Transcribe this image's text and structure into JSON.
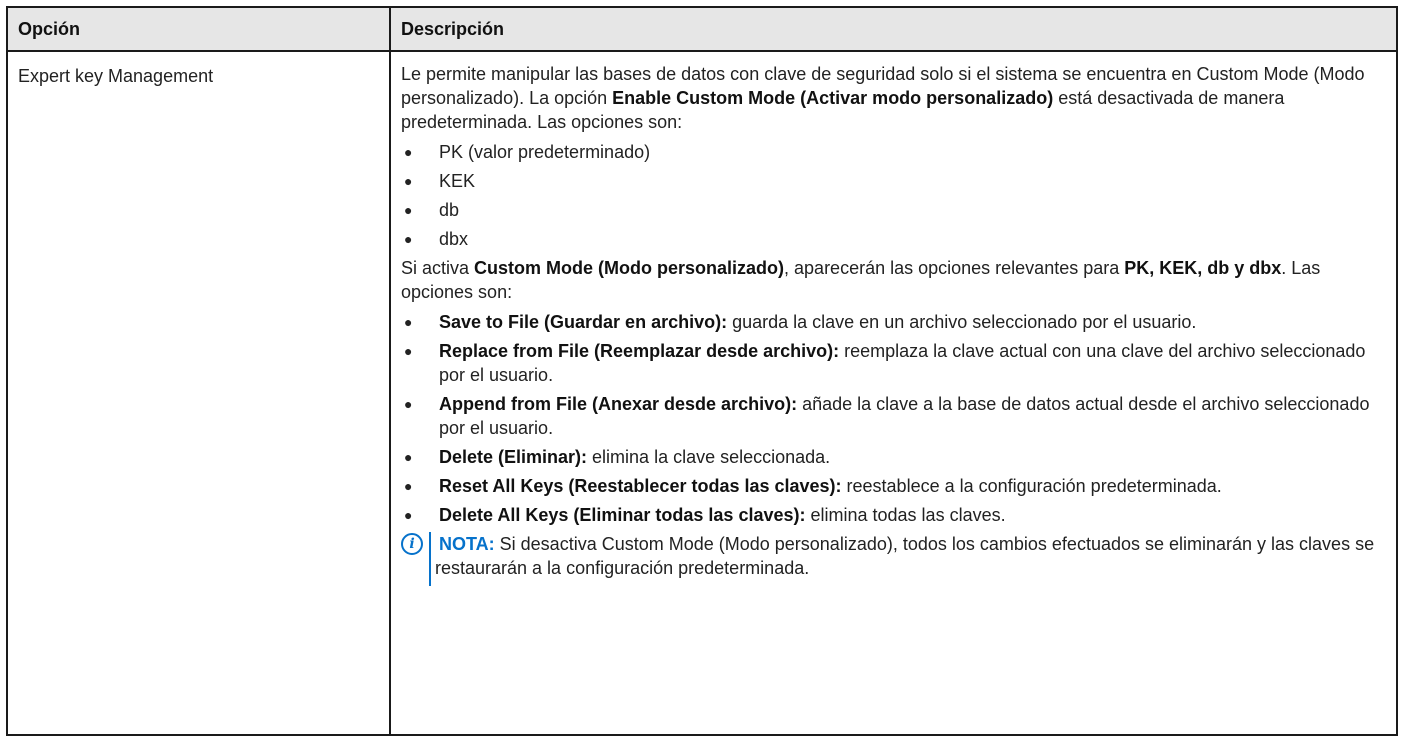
{
  "table": {
    "headers": {
      "option": "Opción",
      "description": "Descripción"
    },
    "row": {
      "option": "Expert key Management",
      "intro": {
        "t1": "Le permite manipular las bases de datos con clave de seguridad solo si el sistema se encuentra en Custom Mode (Modo personalizado). La opción ",
        "b1": "Enable Custom Mode (Activar modo personalizado)",
        "t2": " está desactivada de manera predeterminada. Las opciones son:"
      },
      "options_list": [
        "PK (valor predeterminado)",
        "KEK",
        "db",
        "dbx"
      ],
      "custom": {
        "t1": "Si activa ",
        "b1": "Custom Mode (Modo personalizado)",
        "t2": ", aparecerán las opciones relevantes para ",
        "b2": "PK, KEK, db y dbx",
        "t3": ". Las opciones son:"
      },
      "actions": [
        {
          "label": "Save to File (Guardar en archivo):",
          "text": " guarda la clave en un archivo seleccionado por el usuario."
        },
        {
          "label": "Replace from File (Reemplazar desde archivo):",
          "text": " reemplaza la clave actual con una clave del archivo seleccionado por el usuario."
        },
        {
          "label": "Append from File (Anexar desde archivo):",
          "text": " añade la clave a la base de datos actual desde el archivo seleccionado por el usuario."
        },
        {
          "label": "Delete (Eliminar):",
          "text": " elimina la clave seleccionada."
        },
        {
          "label": "Reset All Keys (Reestablecer todas las claves):",
          "text": " reestablece a la configuración predeterminada."
        },
        {
          "label": "Delete All Keys (Eliminar todas las claves):",
          "text": " elimina todas las claves."
        }
      ],
      "note": {
        "icon": "info-icon",
        "label": "NOTA:",
        "text": " Si desactiva Custom Mode (Modo personalizado), todos los cambios efectuados se eliminarán y las claves se restaurarán a la configuración predeterminada."
      },
      "bullet": "●"
    }
  },
  "colors": {
    "note_accent": "#0672cb",
    "header_bg": "#e6e6e6",
    "border": "#1a1a1a"
  }
}
